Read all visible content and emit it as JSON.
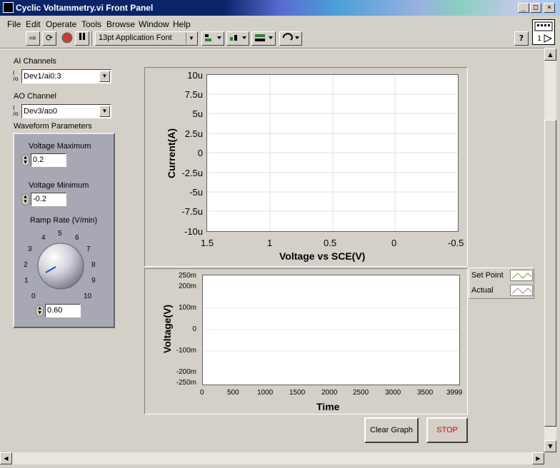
{
  "window": {
    "title": "Cyclic Voltammetry.vi Front Panel"
  },
  "menu": [
    "File",
    "Edit",
    "Operate",
    "Tools",
    "Browse",
    "Window",
    "Help"
  ],
  "toolbar": {
    "font": "13pt Application Font"
  },
  "ai_channels": {
    "label": "AI Channels",
    "value": "Dev1/ai0:3"
  },
  "ao_channel": {
    "label": "AO Channel",
    "value": "Dev3/ao0"
  },
  "waveform": {
    "label": "Waveform Parameters",
    "vmax_label": "Voltage Maximum",
    "vmax": "0.2",
    "vmin_label": "Voltage Minimum",
    "vmin": "-0.2",
    "ramp_label": "Ramp Rate (V/min)",
    "ramp": "0.60",
    "dial_ticks": [
      "0",
      "1",
      "2",
      "3",
      "4",
      "5",
      "6",
      "7",
      "8",
      "9",
      "10"
    ]
  },
  "graph1": {
    "ylabel": "Current(A)",
    "xlabel": "Voltage vs SCE(V)",
    "yticks": [
      "10u",
      "7.5u",
      "5u",
      "2.5u",
      "0",
      "-2.5u",
      "-5u",
      "-7.5u",
      "-10u"
    ],
    "xticks": [
      "1.5",
      "1",
      "0.5",
      "0",
      "-0.5"
    ]
  },
  "graph2": {
    "ylabel": "Voltage(V)",
    "xlabel": "Time",
    "yticks": [
      "250m",
      "200m",
      "100m",
      "0",
      "-100m",
      "-200m",
      "-250m"
    ],
    "xticks": [
      "0",
      "500",
      "1000",
      "1500",
      "2000",
      "2500",
      "3000",
      "3500",
      "3999"
    ]
  },
  "legend": {
    "set_point": "Set Point",
    "actual": "Actual"
  },
  "buttons": {
    "clear": "Clear Graph",
    "stop": "STOP"
  },
  "colors": {
    "stop_text": "#e00000",
    "plot_bg": "#ffffff",
    "grid": "#e0e0e0",
    "dial_pointer": "#2050c0"
  }
}
